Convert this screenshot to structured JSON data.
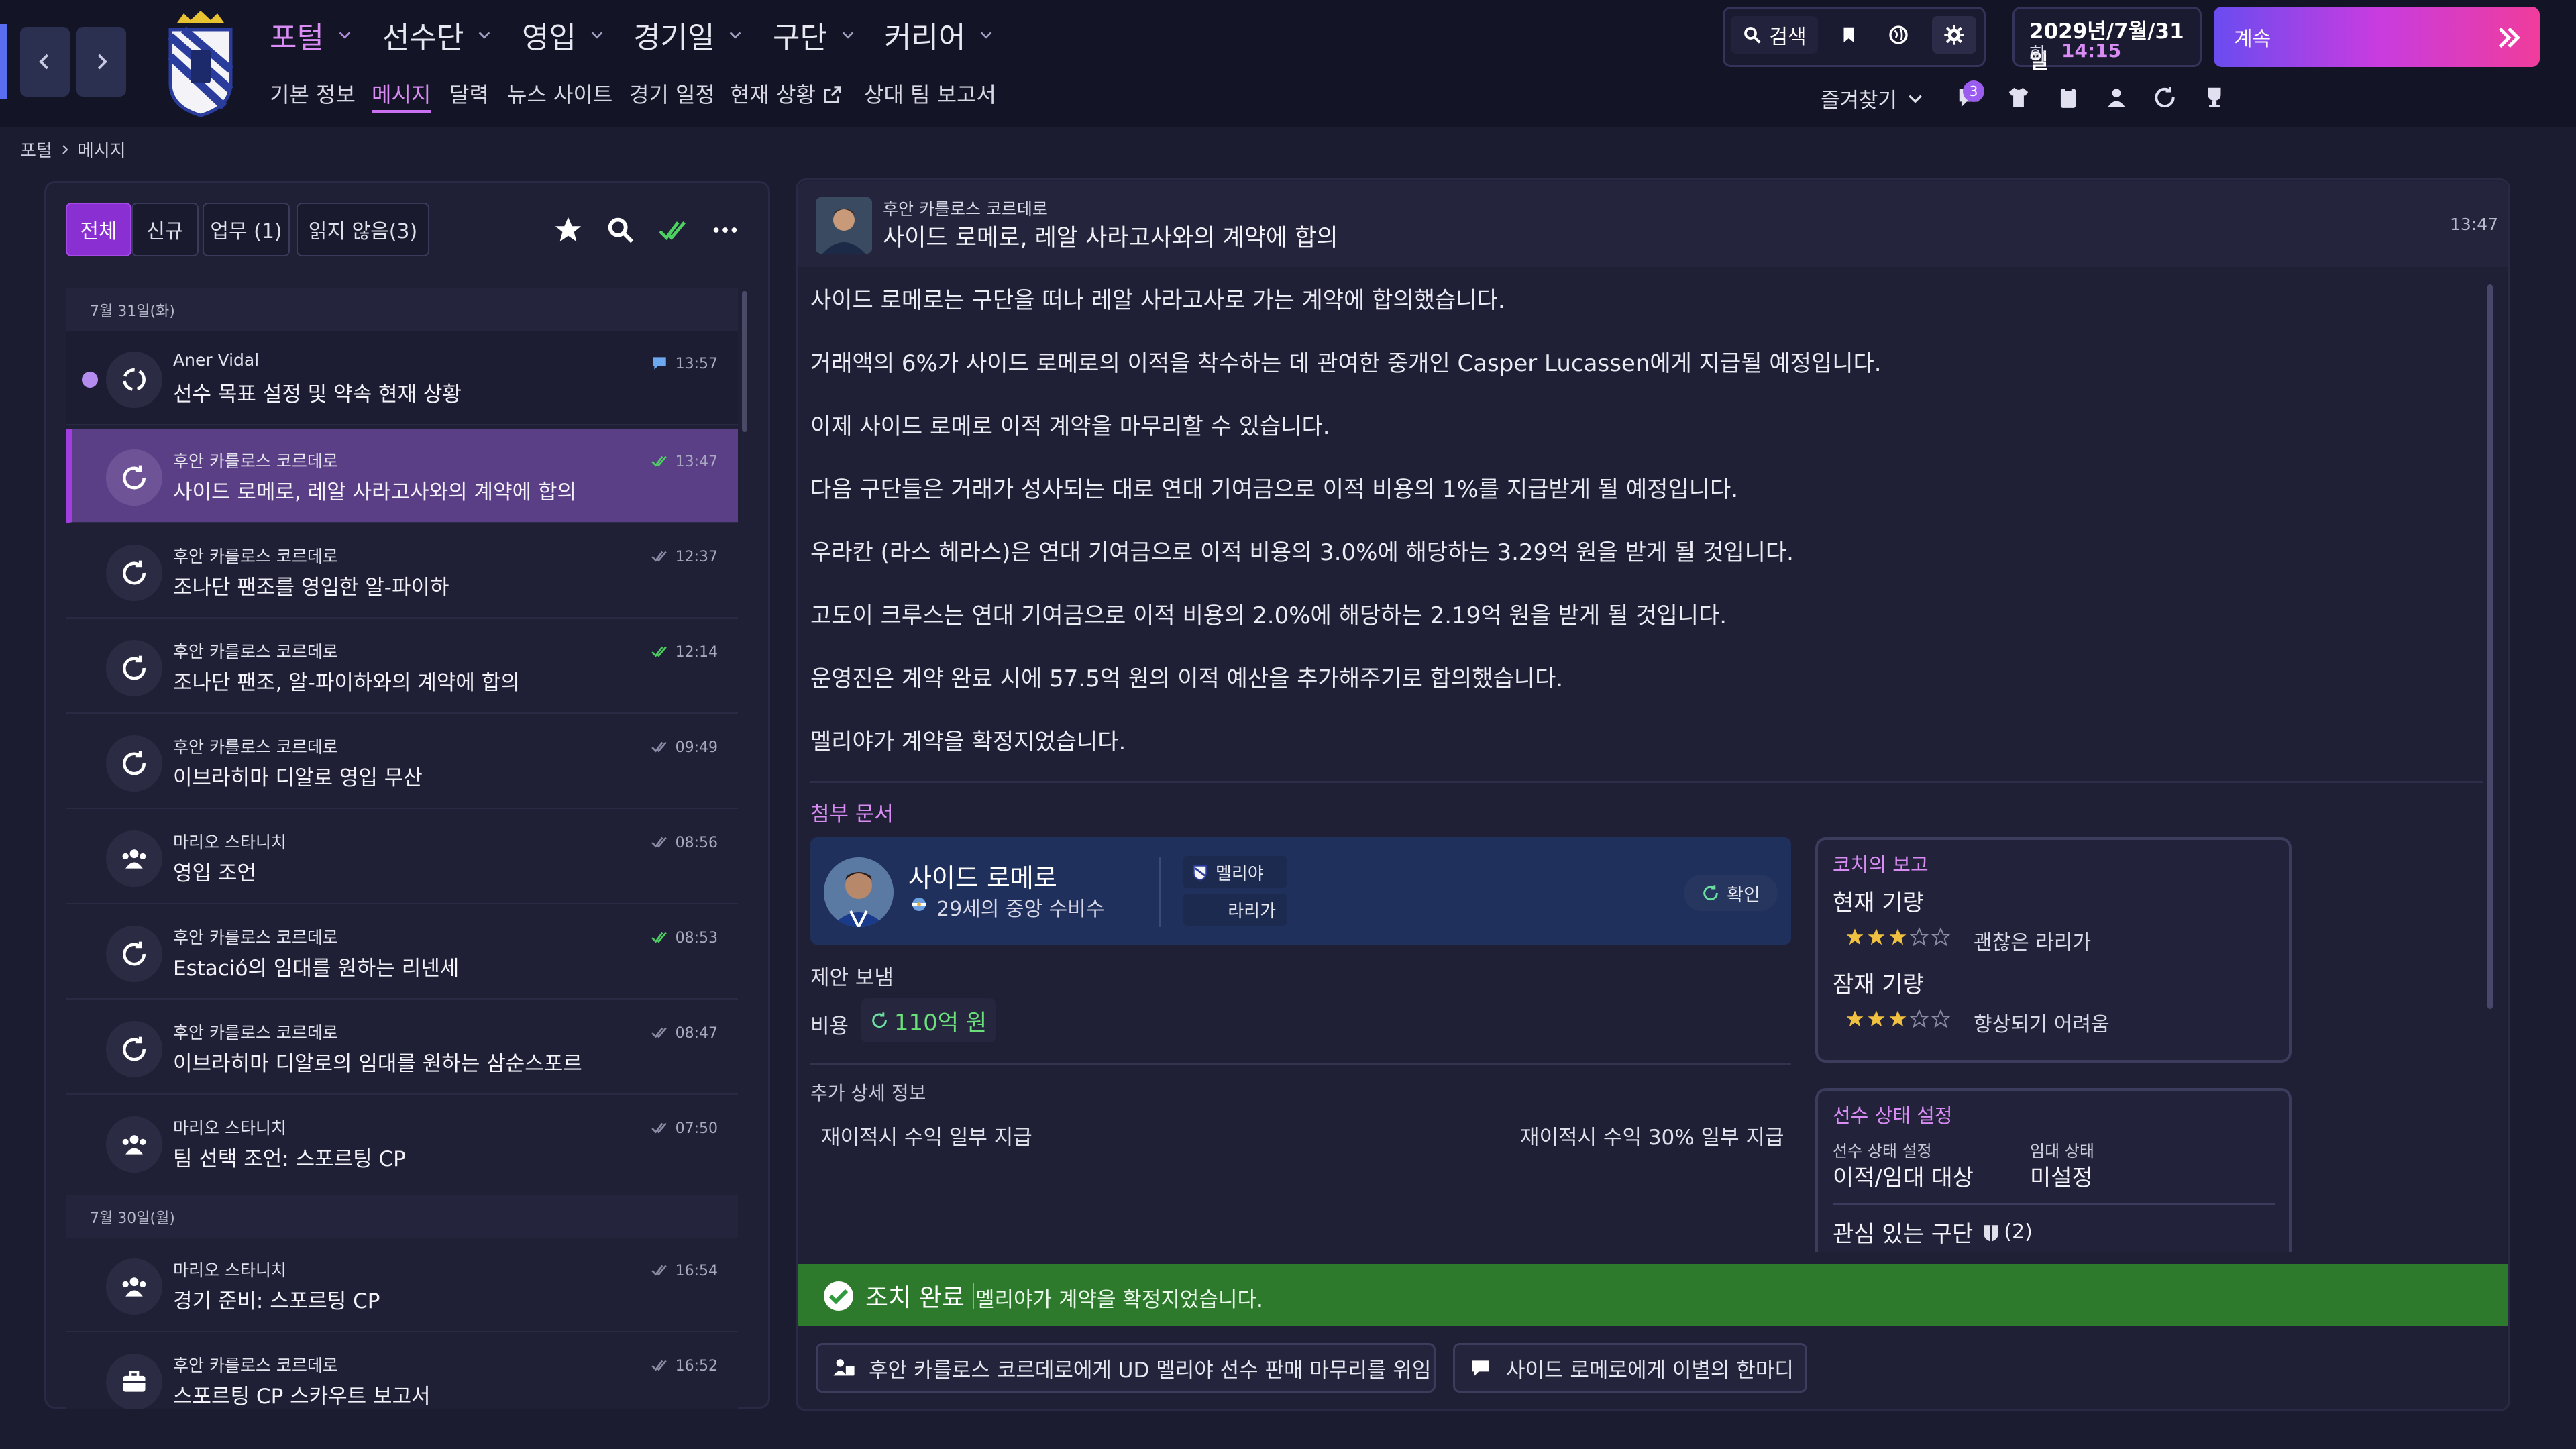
{
  "topbar": {
    "menu": [
      "포털",
      "선수단",
      "영입",
      "경기일",
      "구단",
      "커리어"
    ],
    "submenu": [
      "기본 정보",
      "메시지",
      "달력",
      "뉴스 사이트",
      "경기 일정",
      "현재 상황",
      "상대 팀 보고서"
    ],
    "search_label": "검색",
    "date_line1": "2029년/7월/31일",
    "date_day": "화",
    "date_time": "14:15",
    "continue_label": "계속",
    "favorites_label": "즐겨찾기",
    "notif_count": "3"
  },
  "breadcrumb": {
    "root": "포털",
    "current": "메시지"
  },
  "tabs": {
    "all": "전체",
    "new": "신규",
    "tasks": "업무 (1)",
    "unread": "읽지 않음(3)"
  },
  "messages": {
    "date1": "7월 31일(화)",
    "date2": "7월 30일(월)",
    "items": [
      {
        "sender": "Aner Vidal",
        "subject": "선수 목표 설정 및 약속 현재 상황",
        "time": "13:57"
      },
      {
        "sender": "후안 카를로스 코르데로",
        "subject": "사이드 로메로, 레알 사라고사와의 계약에 합의",
        "time": "13:47"
      },
      {
        "sender": "후안 카를로스 코르데로",
        "subject": "조나단 팬조를 영입한 알-파이하",
        "time": "12:37"
      },
      {
        "sender": "후안 카를로스 코르데로",
        "subject": "조나단 팬조, 알-파이하와의 계약에 합의",
        "time": "12:14"
      },
      {
        "sender": "후안 카를로스 코르데로",
        "subject": "이브라히마 디알로 영입 무산",
        "time": "09:49"
      },
      {
        "sender": "마리오 스타니치",
        "subject": "영입 조언",
        "time": "08:56"
      },
      {
        "sender": "후안 카를로스 코르데로",
        "subject": "Estació의 임대를 원하는 리넨세",
        "time": "08:53"
      },
      {
        "sender": "후안 카를로스 코르데로",
        "subject": "이브라히마 디알로의 임대를 원하는 삼순스포르",
        "time": "08:47"
      },
      {
        "sender": "마리오 스타니치",
        "subject": "팀 선택 조언: 스포르팅 CP",
        "time": "07:50"
      },
      {
        "sender": "마리오 스타니치",
        "subject": "경기 준비: 스포르팅 CP",
        "time": "16:54"
      },
      {
        "sender": "후안 카를로스 코르데로",
        "subject": "스포르팅 CP 스카우트 보고서",
        "time": "16:52"
      }
    ]
  },
  "detail": {
    "sender": "후안 카를로스 코르데로",
    "subject": "사이드 로메로, 레알 사라고사와의 계약에 합의",
    "time": "13:47",
    "paragraphs": [
      "사이드 로메로는 구단을 떠나 레알 사라고사로 가는 계약에 합의했습니다.",
      "거래액의 6%가 사이드 로메로의 이적을 착수하는 데 관여한 중개인 Casper Lucassen에게 지급될 예정입니다.",
      "이제 사이드 로메로 이적 계약을 마무리할 수 있습니다.",
      "다음 구단들은 거래가 성사되는 대로 연대 기여금으로 이적 비용의 1%를 지급받게 될 예정입니다.",
      "우라칸 (라스 헤라스)은 연대 기여금으로 이적 비용의 3.0%에 해당하는 3.29억 원을 받게 될 것입니다.",
      "고도이 크루스는 연대 기여금으로 이적 비용의 2.0%에 해당하는 2.19억 원을 받게 될 것입니다.",
      "운영진은 계약 완료 시에 57.5억 원의 이적 예산을 추가해주기로 합의했습니다.",
      "멜리야가 계약을 확정지었습니다."
    ],
    "attach_title": "첨부 문서",
    "player_name": "사이드 로메로",
    "player_desc": "29세의 중앙 수비수",
    "club_from": "멜리야",
    "club_to": "라리가",
    "confirm_label": "확인",
    "offer_label": "제안 보냄",
    "fee_label": "비용",
    "fee_value": "110억 원",
    "extra_title": "추가 상세 정보",
    "extra_left": "재이적시 수익 일부 지급",
    "extra_right": "재이적시 수익 30% 일부 지급"
  },
  "coach": {
    "title": "코치의 보고",
    "current_label": "현재 기량",
    "current_stars": 3,
    "current_text": "괜찮은 라리가",
    "potential_label": "잠재 기량",
    "potential_stars": 3,
    "potential_text": "향상되기 어려움"
  },
  "status": {
    "title": "선수 상태 설정",
    "status_label": "선수 상태 설정",
    "status_value": "이적/임대 대상",
    "loan_label": "임대 상태",
    "loan_value": "미설정",
    "clubs_label": "관심 있는 구단",
    "clubs_count": "(2)"
  },
  "done": {
    "label": "조치 완료",
    "text": "멜리야가 계약을 확정지었습니다."
  },
  "actions": {
    "delegate": "후안 카를로스 코르데로에게 UD 멜리야 선수 판매 마무리를 위임",
    "farewell": "사이드 로메로에게 이별의 한마디"
  },
  "colors": {
    "accent": "#a03ee0",
    "green": "#2e7a2c",
    "star": "#f0c040"
  }
}
